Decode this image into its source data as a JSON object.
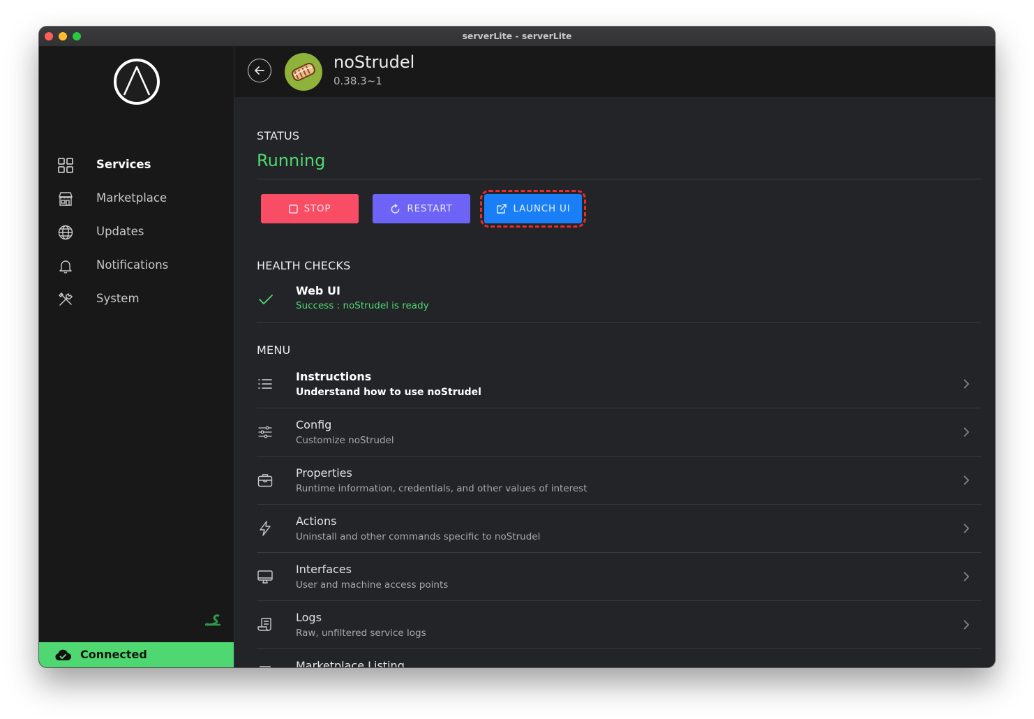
{
  "window": {
    "title": "serverLite - serverLite"
  },
  "sidebar": {
    "items": [
      {
        "label": "Services",
        "icon": "grid-icon",
        "active": true
      },
      {
        "label": "Marketplace",
        "icon": "storefront-icon"
      },
      {
        "label": "Updates",
        "icon": "globe-icon"
      },
      {
        "label": "Notifications",
        "icon": "bell-icon"
      },
      {
        "label": "System",
        "icon": "tools-icon"
      }
    ],
    "connection": {
      "label": "Connected",
      "icon": "cloud-check-icon"
    }
  },
  "header": {
    "app_name": "noStrudel",
    "version": "0.38.3~1"
  },
  "status": {
    "title": "STATUS",
    "value": "Running"
  },
  "buttons": {
    "stop": "STOP",
    "restart": "RESTART",
    "launch": "LAUNCH UI"
  },
  "health": {
    "title": "HEALTH CHECKS",
    "checks": [
      {
        "name": "Web UI",
        "message": "Success : noStrudel is ready"
      }
    ]
  },
  "menu": {
    "title": "MENU",
    "items": [
      {
        "title": "Instructions",
        "subtitle": "Understand how to use noStrudel",
        "icon": "list-icon"
      },
      {
        "title": "Config",
        "subtitle": "Customize noStrudel",
        "icon": "sliders-icon"
      },
      {
        "title": "Properties",
        "subtitle": "Runtime information, credentials, and other values of interest",
        "icon": "briefcase-icon"
      },
      {
        "title": "Actions",
        "subtitle": "Uninstall and other commands specific to noStrudel",
        "icon": "flash-icon"
      },
      {
        "title": "Interfaces",
        "subtitle": "User and machine access points",
        "icon": "desktop-icon"
      },
      {
        "title": "Logs",
        "subtitle": "Raw, unfiltered service logs",
        "icon": "receipt-icon"
      },
      {
        "title": "Marketplace Listing",
        "subtitle": "",
        "icon": "storefront-icon"
      }
    ]
  },
  "colors": {
    "accent_green": "#4fd871",
    "stop_red": "#f94d65",
    "restart_purple": "#6d63f7",
    "launch_blue": "#1a7ef6",
    "highlight_red": "#ea2c2e"
  }
}
